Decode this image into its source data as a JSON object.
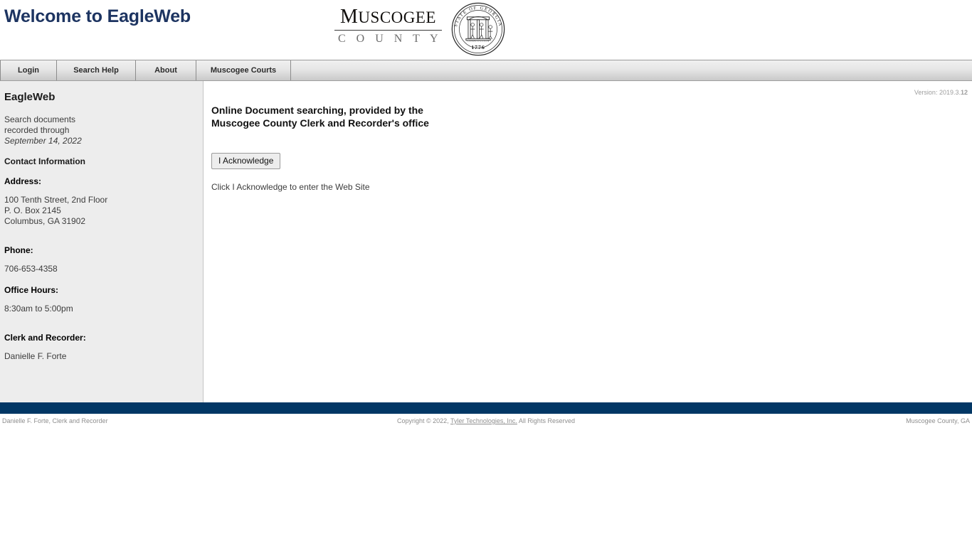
{
  "header": {
    "title": "Welcome to EagleWeb",
    "logo": {
      "line1": "Muscogee",
      "line2": "C O U N T Y",
      "seal_alt": "State of Georgia seal",
      "seal_top_text": "STATE OF GEORGIA",
      "seal_year": "1776"
    }
  },
  "nav": {
    "tabs": [
      {
        "label": "Login",
        "name": "login"
      },
      {
        "label": "Search Help",
        "name": "search-help"
      },
      {
        "label": "About",
        "name": "about"
      },
      {
        "label": "Muscogee Courts",
        "name": "muscogee-courts"
      }
    ]
  },
  "sidebar": {
    "title": "EagleWeb",
    "blurb_line1": "Search documents",
    "blurb_line2": "recorded through",
    "blurb_date": "September 14, 2022",
    "contact_heading": "Contact Information",
    "address_label": "Address:",
    "address_line1": "100 Tenth Street, 2nd Floor",
    "address_line2": "P. O. Box 2145",
    "address_line3": "Columbus, GA 31902",
    "phone_label": "Phone:",
    "phone_value": "706-653-4358",
    "hours_label": "Office Hours:",
    "hours_value": "8:30am to 5:00pm",
    "clerk_label": "Clerk and Recorder:",
    "clerk_value": "Danielle F. Forte"
  },
  "main": {
    "version_prefix": "Version: 2019.3.",
    "version_build": "12",
    "headline_line1": "Online Document searching, provided by the",
    "headline_line2": "Muscogee County Clerk and Recorder's office",
    "acknowledge_label": "I Acknowledge",
    "acknowledge_hint": "Click I Acknowledge to enter the Web Site"
  },
  "footer": {
    "left": "Danielle F. Forte, Clerk and Recorder",
    "copyright_prefix": "Copyright © 2022, ",
    "copyright_link": "Tyler Technologies, Inc.",
    "copyright_suffix": " All Rights Reserved",
    "right": "Muscogee County, GA"
  },
  "colors": {
    "title_navy": "#1d3461",
    "footer_navy": "#023765",
    "sidebar_bg": "#ededed",
    "nav_bg_top": "#f0f0f0",
    "nav_bg_bottom": "#c9c9c9"
  }
}
